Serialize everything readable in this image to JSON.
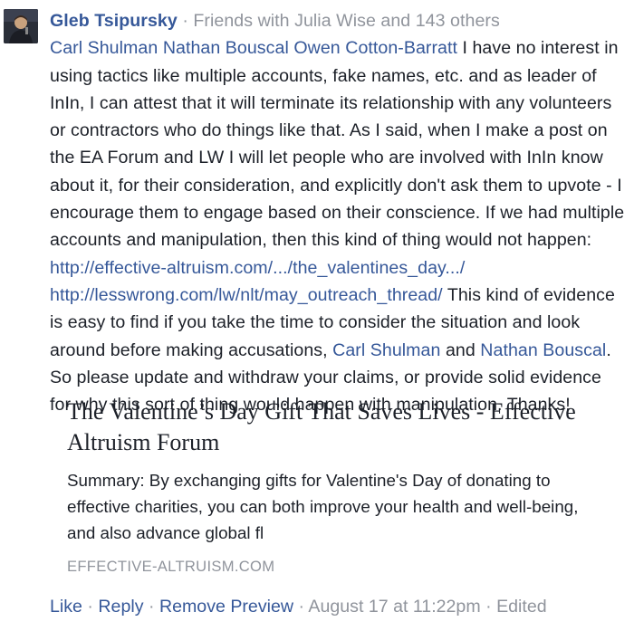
{
  "comment": {
    "author": "Gleb Tsipursky",
    "separator": "·",
    "audience": "Friends with Julia Wise and 143 others",
    "mentions": [
      "Carl Shulman",
      "Nathan Bouscal",
      "Owen Cotton-Barratt"
    ],
    "text_part1": "I have no interest in using tactics like multiple accounts, fake names, etc. and as leader of InIn, I can attest that it will terminate its relationship with any volunteers or contractors who do things like that. As I said, when I make a post on the EA Forum and LW I will let people who are involved with InIn know about it, for their consideration, and explicitly don't ask them to upvote - I encourage them to engage based on their conscience. If we had multiple accounts and manipulation, then this kind of thing would not happen:",
    "link1": "http://effective-altruism.com/.../the_valentines_day.../",
    "link2": "http://lesswrong.com/lw/nlt/may_outreach_thread/",
    "text_part2": "This kind of evidence is easy to find if you take the time to consider the situation and look around before making accusations,",
    "mention_end1": "Carl Shulman",
    "text_and": "and",
    "mention_end2": "Nathan Bouscal",
    "text_part3": ". So please update and withdraw your claims, or provide solid evidence for why this sort of thing would happen with manipulation. Thanks!"
  },
  "preview": {
    "title": "The Valentine’s Day Gift That Saves Lives - Effective Altruism Forum",
    "summary": "Summary: By exchanging gifts for Valentine's Day of donating to effective charities, you can both improve your health and well-being, and also advance global fl",
    "domain": "EFFECTIVE-ALTRUISM.COM"
  },
  "actions": {
    "like": "Like",
    "reply": "Reply",
    "remove_preview": "Remove Preview",
    "timestamp": "August 17 at 11:22pm",
    "edited": "Edited",
    "separator": "·"
  },
  "colors": {
    "link": "#365899",
    "meta": "#90949c",
    "text": "#1d2129"
  },
  "icons": {
    "avatar": "profile-photo"
  }
}
